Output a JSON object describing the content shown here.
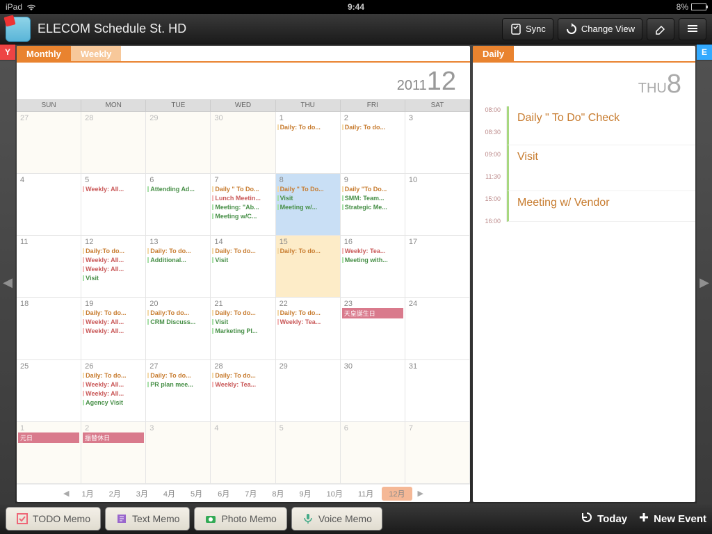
{
  "status": {
    "device": "iPad",
    "time": "9:44",
    "battery": "8%"
  },
  "header": {
    "title": "ELECOM Schedule St. HD",
    "sync": "Sync",
    "change_view": "Change View"
  },
  "side": {
    "y": "Y",
    "e": "E"
  },
  "month_panel": {
    "tabs": {
      "monthly": "Monthly",
      "weekly": "Weekly"
    },
    "year": "2011",
    "month": "12",
    "dow": [
      "SUN",
      "MON",
      "TUE",
      "WED",
      "THU",
      "FRI",
      "SAT"
    ],
    "months_nav": [
      "1月",
      "2月",
      "3月",
      "4月",
      "5月",
      "6月",
      "7月",
      "8月",
      "9月",
      "10月",
      "11月",
      "12月"
    ],
    "cells": [
      {
        "n": "27",
        "other": true
      },
      {
        "n": "28",
        "other": true
      },
      {
        "n": "29",
        "other": true
      },
      {
        "n": "30",
        "other": true
      },
      {
        "n": "1",
        "ev": [
          {
            "t": "Daily: To do...",
            "c": "c1"
          }
        ]
      },
      {
        "n": "2",
        "ev": [
          {
            "t": "Daily: To do...",
            "c": "c1"
          }
        ]
      },
      {
        "n": "3"
      },
      {
        "n": "4"
      },
      {
        "n": "5",
        "ev": [
          {
            "t": "Weekly: All...",
            "c": "c3"
          }
        ]
      },
      {
        "n": "6",
        "ev": [
          {
            "t": "Attending Ad...",
            "c": "c2"
          }
        ]
      },
      {
        "n": "7",
        "ev": [
          {
            "t": "Daily \" To Do...",
            "c": "c1"
          },
          {
            "t": "Lunch Meetin...",
            "c": "c3"
          },
          {
            "t": "Meeting: \"Ab...",
            "c": "c2"
          },
          {
            "t": "Meeting w/C...",
            "c": "c2"
          }
        ]
      },
      {
        "n": "8",
        "selected": true,
        "ev": [
          {
            "t": "Daily \" To Do...",
            "c": "c1"
          },
          {
            "t": "Visit",
            "c": "c2"
          },
          {
            "t": "Meeting w/...",
            "c": "c2"
          }
        ]
      },
      {
        "n": "9",
        "ev": [
          {
            "t": "Daily \"To Do...",
            "c": "c1"
          },
          {
            "t": "SMM: Team...",
            "c": "c2"
          },
          {
            "t": "Strategic Me...",
            "c": "c2"
          }
        ]
      },
      {
        "n": "10"
      },
      {
        "n": "11"
      },
      {
        "n": "12",
        "ev": [
          {
            "t": "Daily:To do...",
            "c": "c1"
          },
          {
            "t": "Weekly: All...",
            "c": "c3"
          },
          {
            "t": "Weekly: All...",
            "c": "c3"
          },
          {
            "t": "Visit",
            "c": "c2"
          }
        ]
      },
      {
        "n": "13",
        "ev": [
          {
            "t": "Daily: To do...",
            "c": "c1"
          },
          {
            "t": "Additional...",
            "c": "c2"
          }
        ]
      },
      {
        "n": "14",
        "ev": [
          {
            "t": "Daily: To do...",
            "c": "c1"
          },
          {
            "t": "Visit",
            "c": "c2"
          }
        ]
      },
      {
        "n": "15",
        "shade": true,
        "ev": [
          {
            "t": "Daily: To do...",
            "c": "c1"
          }
        ]
      },
      {
        "n": "16",
        "ev": [
          {
            "t": "Weekly: Tea...",
            "c": "c3"
          },
          {
            "t": "Meeting with...",
            "c": "c2"
          }
        ]
      },
      {
        "n": "17"
      },
      {
        "n": "18"
      },
      {
        "n": "19",
        "ev": [
          {
            "t": "Daily: To do...",
            "c": "c1"
          },
          {
            "t": "Weekly: All...",
            "c": "c3"
          },
          {
            "t": "Weekly: All...",
            "c": "c3"
          }
        ]
      },
      {
        "n": "20",
        "ev": [
          {
            "t": "Daily:To do...",
            "c": "c1"
          },
          {
            "t": "CRM Discuss...",
            "c": "c2"
          }
        ]
      },
      {
        "n": "21",
        "ev": [
          {
            "t": "Daily: To do...",
            "c": "c1"
          },
          {
            "t": "Visit",
            "c": "c2"
          },
          {
            "t": "Marketing Pl...",
            "c": "c2"
          }
        ]
      },
      {
        "n": "22",
        "ev": [
          {
            "t": "Daily: To do...",
            "c": "c1"
          },
          {
            "t": "Weekly: Tea...",
            "c": "c3"
          }
        ]
      },
      {
        "n": "23",
        "banner": "天皇誕生日"
      },
      {
        "n": "24"
      },
      {
        "n": "25"
      },
      {
        "n": "26",
        "ev": [
          {
            "t": "Daily: To do...",
            "c": "c1"
          },
          {
            "t": "Weekly: All...",
            "c": "c3"
          },
          {
            "t": "Weekly: All...",
            "c": "c3"
          },
          {
            "t": "Agency Visit",
            "c": "c2"
          }
        ]
      },
      {
        "n": "27",
        "ev": [
          {
            "t": "Daily: To do...",
            "c": "c1"
          },
          {
            "t": "PR plan mee...",
            "c": "c2"
          }
        ]
      },
      {
        "n": "28",
        "ev": [
          {
            "t": "Daily: To do...",
            "c": "c1"
          },
          {
            "t": "Weekly: Tea...",
            "c": "c3"
          }
        ]
      },
      {
        "n": "29"
      },
      {
        "n": "30"
      },
      {
        "n": "31"
      },
      {
        "n": "1",
        "other": true,
        "banner": "元日"
      },
      {
        "n": "2",
        "other": true,
        "banner": "振替休日"
      },
      {
        "n": "3",
        "other": true
      },
      {
        "n": "4",
        "other": true
      },
      {
        "n": "5",
        "other": true
      },
      {
        "n": "6",
        "other": true
      },
      {
        "n": "7",
        "other": true
      }
    ]
  },
  "day_panel": {
    "tab": "Daily",
    "dow": "THU",
    "day": "8",
    "hours": [
      "08:00",
      "08:30",
      "09:00",
      "11:30",
      "15:00",
      "16:00"
    ],
    "events": [
      {
        "t": "Daily \" To Do\" Check",
        "h": "h1"
      },
      {
        "t": "Visit",
        "h": "h2"
      },
      {
        "t": "Meeting w/ Vendor",
        "h": "h3"
      }
    ]
  },
  "bottom": {
    "todo": "TODO Memo",
    "text": "Text Memo",
    "photo": "Photo Memo",
    "voice": "Voice Memo",
    "today": "Today",
    "new": "New Event"
  }
}
